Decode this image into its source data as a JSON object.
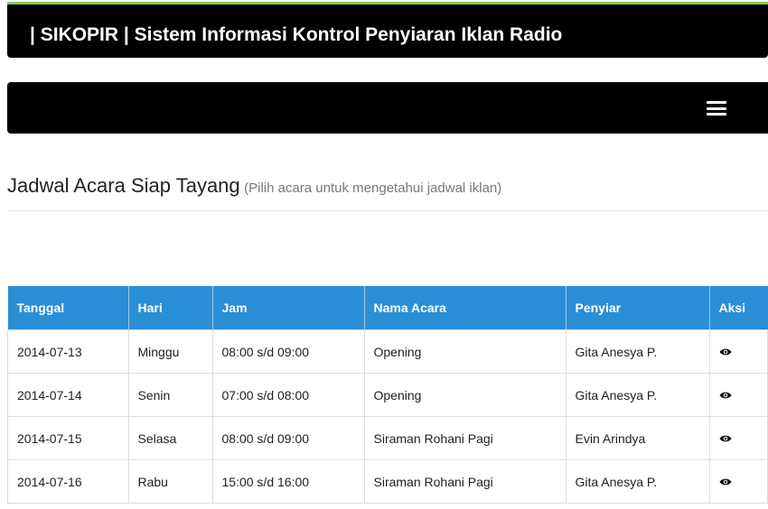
{
  "header": {
    "title": "| SIKOPIR | Sistem Informasi Kontrol Penyiaran Iklan Radio"
  },
  "navbar": {
    "menu_icon": "hamburger-menu-icon"
  },
  "page": {
    "heading": "Jadwal Acara Siap Tayang",
    "subheading": "(Pilih acara untuk mengetahui jadwal iklan)"
  },
  "table": {
    "headers": [
      "Tanggal",
      "Hari",
      "Jam",
      "Nama Acara",
      "Penyiar",
      "Aksi"
    ],
    "rows": [
      {
        "tanggal": "2014-07-13",
        "hari": "Minggu",
        "jam": "08:00 s/d 09:00",
        "acara": "Opening",
        "penyiar": "Gita Anesya P.",
        "aksi_icon": "eye-icon"
      },
      {
        "tanggal": "2014-07-14",
        "hari": "Senin",
        "jam": "07:00 s/d 08:00",
        "acara": "Opening",
        "penyiar": "Gita Anesya P.",
        "aksi_icon": "eye-icon"
      },
      {
        "tanggal": "2014-07-15",
        "hari": "Selasa",
        "jam": "08:00 s/d 09:00",
        "acara": "Siraman Rohani Pagi",
        "penyiar": "Evin Arindya",
        "aksi_icon": "eye-icon"
      },
      {
        "tanggal": "2014-07-16",
        "hari": "Rabu",
        "jam": "15:00 s/d 16:00",
        "acara": "Siraman Rohani Pagi",
        "penyiar": "Gita Anesya P.",
        "aksi_icon": "eye-icon"
      }
    ]
  },
  "colors": {
    "header_bg": "#000000",
    "table_header_bg": "#2a8fd6",
    "accent_line": "#8bc34a"
  }
}
